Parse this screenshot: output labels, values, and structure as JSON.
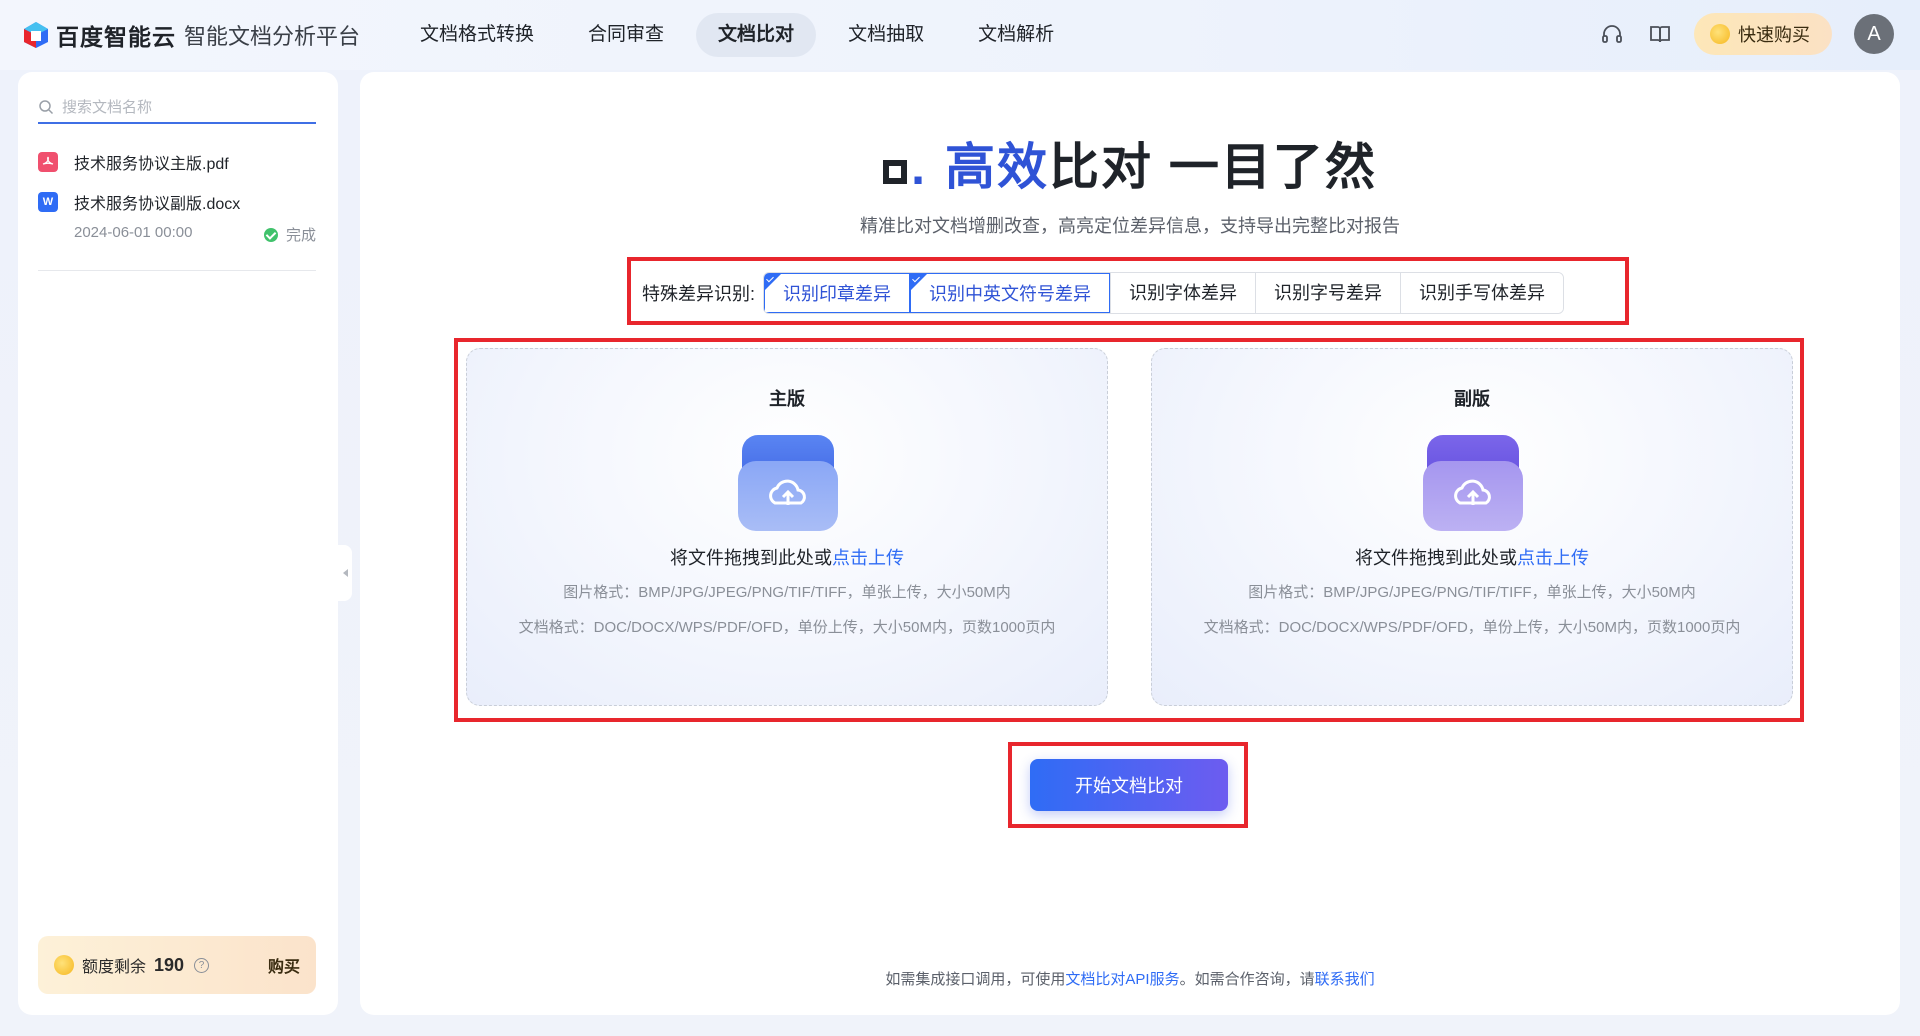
{
  "brand": {
    "logo_text": "百度智能云",
    "platform_name": "智能文档分析平台"
  },
  "nav": {
    "items": [
      {
        "label": "文档格式转换"
      },
      {
        "label": "合同审查"
      },
      {
        "label": "文档比对",
        "active": true
      },
      {
        "label": "文档抽取"
      },
      {
        "label": "文档解析"
      }
    ]
  },
  "header": {
    "buy_label": "快速购买",
    "avatar_initial": "A",
    "icons": [
      "headset-icon",
      "book-icon"
    ]
  },
  "sidebar": {
    "search": {
      "placeholder": "搜索文档名称"
    },
    "files": [
      {
        "name": "技术服务协议主版.pdf",
        "type": "pdf"
      },
      {
        "name": "技术服务协议副版.docx",
        "type": "docx",
        "icon_letter": "W"
      }
    ],
    "meta": {
      "time": "2024-06-01 00:00",
      "status": "完成"
    },
    "quota": {
      "label": "额度剩余",
      "value": "190",
      "buy": "购买",
      "help": "?"
    }
  },
  "main": {
    "title": {
      "part1": "高效",
      "part2": "比对 一目了然"
    },
    "subtitle": "精准比对文档增删改查，高亮定位差异信息，支持导出完整比对报告",
    "special": {
      "label": "特殊差异识别:",
      "options": [
        {
          "label": "识别印章差异",
          "checked": true
        },
        {
          "label": "识别中英文符号差异",
          "checked": true
        },
        {
          "label": "识别字体差异",
          "checked": false
        },
        {
          "label": "识别字号差异",
          "checked": false
        },
        {
          "label": "识别手写体差异",
          "checked": false
        }
      ]
    },
    "upload": {
      "primary": {
        "title": "主版"
      },
      "secondary": {
        "title": "副版"
      },
      "drop_text": "将文件拖拽到此处或",
      "drop_link": "点击上传",
      "image_formats": "图片格式：BMP/JPG/JPEG/PNG/TIF/TIFF，单张上传，大小50M内",
      "doc_formats": "文档格式：DOC/DOCX/WPS/PDF/OFD，单份上传，大小50M内，页数1000页内"
    },
    "start_button": "开始文档比对",
    "footer": {
      "prefix": "如需集成接口调用，可使用",
      "api_link": "文档比对API服务",
      "middle": "。如需合作咨询，请",
      "contact_link": "联系我们"
    }
  },
  "colors": {
    "accent": "#2f6cf5",
    "title_highlight": "#2f53d6",
    "annotation": "#e8262d",
    "primary_folder": "#5b83f0",
    "secondary_folder": "#7b68e6"
  }
}
